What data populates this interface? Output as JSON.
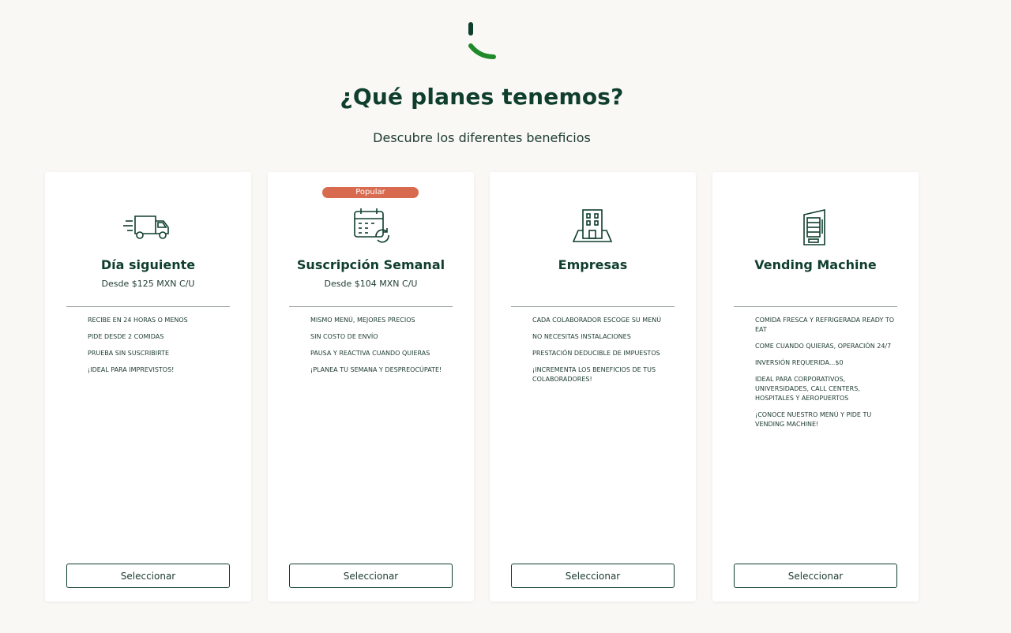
{
  "header": {
    "title": "¿Qué planes tenemos?",
    "subtitle": "Descubre los diferentes beneficios"
  },
  "colors": {
    "brand_green": "#0f3e2d",
    "logo_green": "#1f8a2a",
    "badge_orange": "#d86a4f",
    "background": "#f9f8f5"
  },
  "plans": [
    {
      "icon": "delivery-truck-icon",
      "name": "Día siguiente",
      "price": "Desde $125 MXN C/U",
      "features": [
        "Recibe en 24 horas o menos",
        "Pide desde 2 comidas",
        "Prueba sin suscribirte",
        "¡Ideal para imprevistos!"
      ],
      "button": "Seleccionar"
    },
    {
      "badge": "Popular",
      "icon": "calendar-refresh-icon",
      "name": "Suscripción Semanal",
      "price": "Desde $104 MXN C/U",
      "features": [
        "Mismo menú, mejores precios",
        "Sin costo de envío",
        "Pausa y reactiva cuando quieras",
        "¡Planea tu semana y despreocúpate!"
      ],
      "button": "Seleccionar"
    },
    {
      "icon": "office-building-icon",
      "name": "Empresas",
      "features": [
        "Cada colaborador escoge su menú",
        "No necesitas instalaciones",
        "Prestación deducible de impuestos",
        "¡Incrementa los beneficios de tus colaboradores!"
      ],
      "button": "Seleccionar"
    },
    {
      "icon": "vending-machine-icon",
      "name": "Vending Machine",
      "features": [
        "Comida fresca y refrigerada ready to eat",
        "Come cuando quieras, operación 24/7",
        "Inversión requerida...$0",
        "Ideal para corporativos, universidades, call centers, hospitales y aeropuertos",
        "¡Conoce nuestro menú y pide tu vending machine!"
      ],
      "button": "Seleccionar"
    }
  ]
}
